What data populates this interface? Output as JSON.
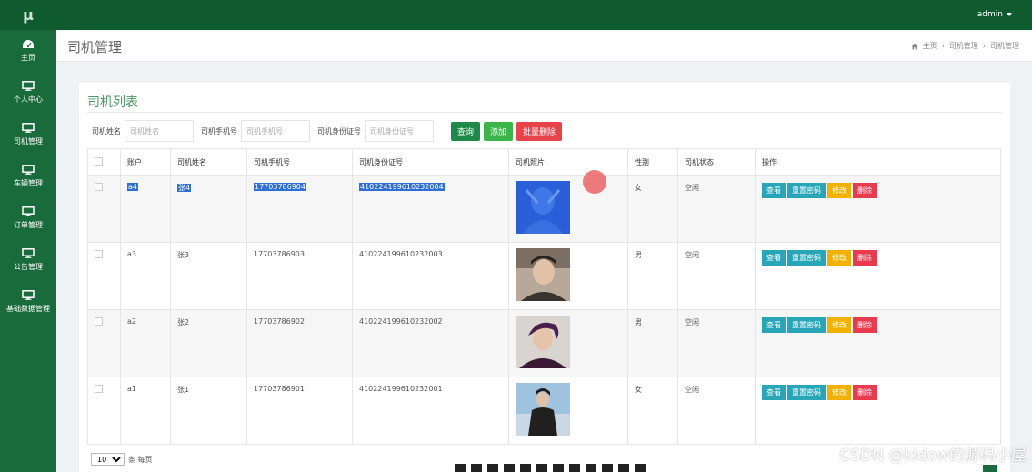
{
  "app": {
    "logo": "μ"
  },
  "header": {
    "user": "admin"
  },
  "sidebar": {
    "items": [
      {
        "label": "主页",
        "icon": "dashboard-icon"
      },
      {
        "label": "个人中心",
        "icon": "monitor-icon"
      },
      {
        "label": "司机管理",
        "icon": "monitor-icon"
      },
      {
        "label": "车辆管理",
        "icon": "monitor-icon"
      },
      {
        "label": "订单管理",
        "icon": "monitor-icon"
      },
      {
        "label": "公告管理",
        "icon": "monitor-icon"
      },
      {
        "label": "基础数据管理",
        "icon": "monitor-icon"
      }
    ]
  },
  "page": {
    "title": "司机管理",
    "breadcrumb": [
      "主页",
      "司机管理",
      "司机管理"
    ]
  },
  "panel": {
    "title": "司机列表",
    "search": {
      "name_label": "司机姓名",
      "name_placeholder": "司机姓名",
      "phone_label": "司机手机号",
      "phone_placeholder": "司机手机号",
      "id_label": "司机身份证号",
      "id_placeholder": "司机身份证号",
      "query_btn": "查询",
      "add_btn": "添加",
      "batch_delete_btn": "批量删除"
    },
    "table": {
      "headers": [
        "账户",
        "司机姓名",
        "司机手机号",
        "司机身份证号",
        "司机照片",
        "性别",
        "司机状态",
        "操作"
      ],
      "rows": [
        {
          "account": "a4",
          "name": "张4",
          "phone": "17703786904",
          "id_card": "410224199610232004",
          "gender": "女",
          "status": "空闲"
        },
        {
          "account": "a3",
          "name": "张3",
          "phone": "17703786903",
          "id_card": "410224199610232003",
          "gender": "男",
          "status": "空闲"
        },
        {
          "account": "a2",
          "name": "张2",
          "phone": "17703786902",
          "id_card": "410224199610232002",
          "gender": "男",
          "status": "空闲"
        },
        {
          "account": "a1",
          "name": "张1",
          "phone": "17703786901",
          "id_card": "410224199610232001",
          "gender": "女",
          "status": "空闲"
        }
      ],
      "actions": {
        "view": "查看",
        "reset": "重置密码",
        "edit": "修改",
        "delete": "删除"
      }
    },
    "pager": {
      "size": "10",
      "suffix": "条 每页"
    }
  },
  "watermark": "CSDN @kidow的源码小屋",
  "colors": {
    "sidebar": "#1a6b3c",
    "topbar": "#0f5a2f",
    "accent": "#4a9a62"
  }
}
